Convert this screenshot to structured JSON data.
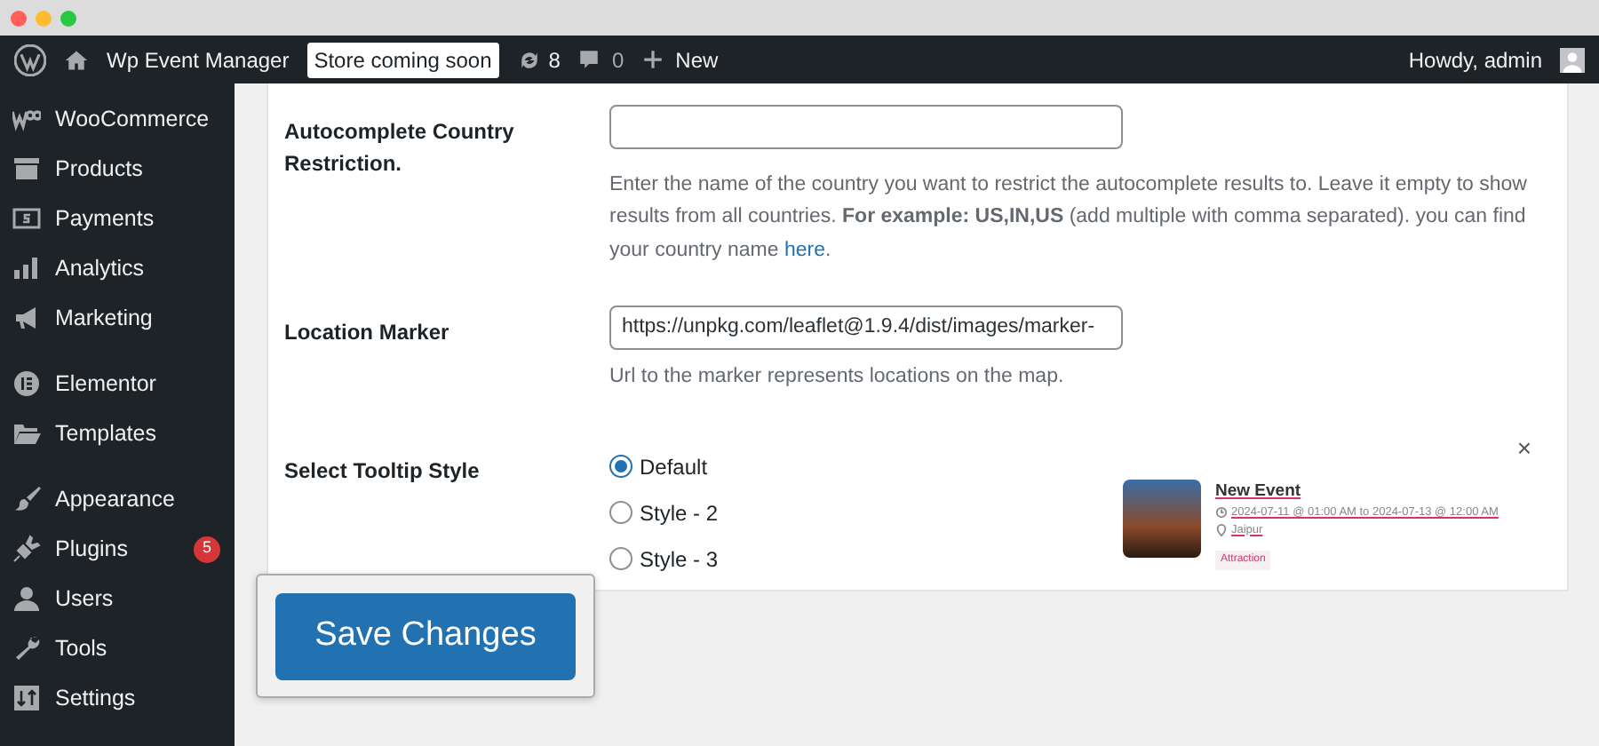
{
  "admin_bar": {
    "site_name": "Wp Event Manager",
    "store_badge": "Store coming soon",
    "updates": "8",
    "comments": "0",
    "new_label": "New",
    "greeting": "Howdy, admin"
  },
  "sidebar": {
    "groups": [
      [
        {
          "label": "WooCommerce"
        },
        {
          "label": "Products"
        },
        {
          "label": "Payments"
        },
        {
          "label": "Analytics"
        },
        {
          "label": "Marketing"
        }
      ],
      [
        {
          "label": "Elementor"
        },
        {
          "label": "Templates"
        }
      ],
      [
        {
          "label": "Appearance"
        },
        {
          "label": "Plugins",
          "badge": "5"
        },
        {
          "label": "Users"
        },
        {
          "label": "Tools"
        },
        {
          "label": "Settings"
        }
      ]
    ]
  },
  "settings": [
    {
      "kind": "text",
      "label": "Autocomplete Country Restriction.",
      "description": "Enter the name of the country you want to restrict the autocomplete results to. Leave it empty to show results from all countries. **For example: US,IN,US** (add multiple with comma separated). you can find your country name",
      "link": "here",
      "tail": "."
    },
    {
      "kind": "text",
      "label": "Location Marker",
      "value": "https://unpkg.com/leaflet@1.9.4/dist/images/marker-",
      "description": "Url to the marker represents locations on the map."
    },
    {
      "kind": "radio",
      "label": "Select Tooltip Style",
      "options": [
        {
          "label": "Default",
          "selected": true
        },
        {
          "label": "Style - 2",
          "selected": false
        },
        {
          "label": "Style - 3",
          "selected": false
        }
      ],
      "preview": {
        "close": "×",
        "title": "New Event",
        "date": "2024-07-11 @ 01:00 AM to 2024-07-13 @ 12:00 AM",
        "location": "Jaipur",
        "tag": "Attraction"
      }
    }
  ],
  "save_button": "Save Changes"
}
